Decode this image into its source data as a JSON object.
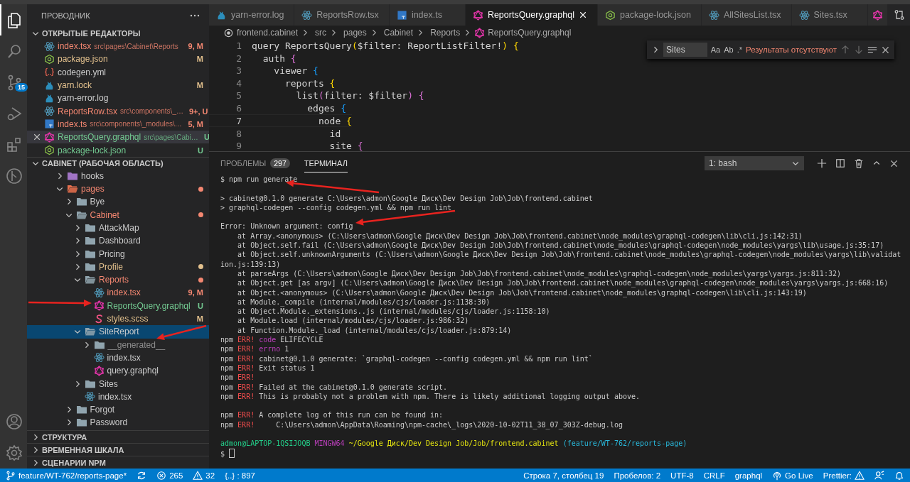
{
  "activity_bar": {
    "items": [
      {
        "kind": "files",
        "selected": true
      },
      {
        "kind": "search",
        "selected": false
      },
      {
        "kind": "source-control",
        "selected": false,
        "badge": "15"
      },
      {
        "kind": "run",
        "selected": false
      },
      {
        "kind": "extensions",
        "selected": false
      },
      {
        "kind": "git-graph",
        "selected": false
      }
    ],
    "bottom": [
      {
        "kind": "account"
      },
      {
        "kind": "settings"
      }
    ]
  },
  "sidebar": {
    "title": "ПРОВОДНИК",
    "open_editors": {
      "title": "ОТКРЫТЫЕ РЕДАКТОРЫ",
      "items": [
        {
          "name": "index.tsx",
          "kind": "react",
          "path": "src\\pages\\Cabinet\\Reports",
          "badge": "9, M",
          "color": "#f48771",
          "selected": false
        },
        {
          "name": "package.json",
          "kind": "json",
          "badge": "M",
          "color": "#e2c08d",
          "selected": false
        },
        {
          "name": "codegen.yml",
          "kind": "yaml",
          "color": "#cccccc",
          "selected": false
        },
        {
          "name": "yarn.lock",
          "kind": "yarn",
          "badge": "M",
          "color": "#e2c08d",
          "selected": false
        },
        {
          "name": "yarn-error.log",
          "kind": "yarn",
          "color": "#cccccc",
          "selected": false
        },
        {
          "name": "ReportsRow.tsx",
          "kind": "react",
          "path": "src\\components\\_…",
          "badge": "9+, U",
          "color": "#f48771",
          "selected": false
        },
        {
          "name": "index.ts",
          "kind": "ts",
          "path": "src\\components\\_modules\\…",
          "badge": "5, M",
          "color": "#f48771",
          "selected": false
        },
        {
          "name": "ReportsQuery.graphql",
          "kind": "graphql",
          "path": "src\\pages\\Cabi…",
          "badge": "U",
          "color": "#73c991",
          "selected": true
        },
        {
          "name": "package-lock.json",
          "kind": "json",
          "badge": "U",
          "color": "#73c991",
          "selected": false
        }
      ]
    },
    "workspace": {
      "title": "CABINET (РАБОЧАЯ ОБЛАСТЬ)",
      "tree": [
        {
          "name": "hooks",
          "kind": "folder-hooks",
          "expanded": false,
          "color": "#cccccc",
          "dot": false,
          "selected": false
        },
        {
          "name": "pages",
          "kind": "folder-pages",
          "expanded": true,
          "color": "#f48771",
          "dot": true,
          "selected": false,
          "children": [
            {
              "name": "Bye",
              "kind": "folder",
              "expanded": false,
              "color": "#cccccc",
              "dot": false,
              "selected": false
            },
            {
              "name": "Cabinet",
              "kind": "folder",
              "expanded": true,
              "color": "#f48771",
              "dot": true,
              "selected": false,
              "children": [
                {
                  "name": "AttackMap",
                  "kind": "folder",
                  "expanded": false,
                  "color": "#cccccc",
                  "dot": false,
                  "selected": false
                },
                {
                  "name": "Dashboard",
                  "kind": "folder",
                  "expanded": false,
                  "color": "#cccccc",
                  "dot": false,
                  "selected": false
                },
                {
                  "name": "Pricing",
                  "kind": "folder",
                  "expanded": false,
                  "color": "#cccccc",
                  "dot": false,
                  "selected": false
                },
                {
                  "name": "Profile",
                  "kind": "folder",
                  "expanded": false,
                  "color": "#e2c08d",
                  "dot": true,
                  "selected": false
                },
                {
                  "name": "Reports",
                  "kind": "folder",
                  "expanded": true,
                  "color": "#f48771",
                  "dot": true,
                  "selected": false,
                  "children": [
                    {
                      "name": "index.tsx",
                      "kind": "react",
                      "badge": "9, M",
                      "color": "#f48771",
                      "selected": false
                    },
                    {
                      "name": "ReportsQuery.graphql",
                      "kind": "graphql",
                      "badge": "U",
                      "color": "#73c991",
                      "selected": false
                    },
                    {
                      "name": "styles.scss",
                      "kind": "scss",
                      "badge": "M",
                      "color": "#e2c08d",
                      "selected": false
                    }
                  ]
                },
                {
                  "name": "SiteReport",
                  "kind": "folder",
                  "expanded": true,
                  "color": "#cccccc",
                  "dot": false,
                  "selected": true,
                  "children": [
                    {
                      "name": "__generated__",
                      "kind": "folder",
                      "expanded": false,
                      "color": "#8c8c8c",
                      "dot": false,
                      "selected": false
                    },
                    {
                      "name": "index.tsx",
                      "kind": "react",
                      "color": "#cccccc",
                      "selected": false
                    },
                    {
                      "name": "query.graphql",
                      "kind": "graphql",
                      "color": "#cccccc",
                      "selected": false
                    }
                  ]
                },
                {
                  "name": "Sites",
                  "kind": "folder",
                  "expanded": false,
                  "color": "#cccccc",
                  "dot": false,
                  "selected": false
                },
                {
                  "name": "index.tsx",
                  "kind": "react",
                  "color": "#cccccc",
                  "selected": false
                }
              ]
            },
            {
              "name": "Forgot",
              "kind": "folder",
              "expanded": false,
              "color": "#cccccc",
              "dot": false,
              "selected": false
            },
            {
              "name": "Password",
              "kind": "folder",
              "expanded": false,
              "color": "#cccccc",
              "dot": false,
              "selected": false
            }
          ]
        }
      ]
    },
    "sections": [
      "СТРУКТУРА",
      "ВРЕМЕННАЯ ШКАЛА",
      "СЦЕНАРИИ NPM"
    ]
  },
  "editor": {
    "tabs": [
      {
        "label": "yarn-error.log",
        "kind": "yarn",
        "selected": false
      },
      {
        "label": "ReportsRow.tsx",
        "kind": "react",
        "selected": false
      },
      {
        "label": "index.ts",
        "kind": "ts",
        "selected": false
      },
      {
        "label": "ReportsQuery.graphql",
        "kind": "graphql",
        "selected": true
      },
      {
        "label": "package-lock.json",
        "kind": "json",
        "selected": false
      },
      {
        "label": "AllSitesList.tsx",
        "kind": "react",
        "selected": false
      },
      {
        "label": "Sites.tsx",
        "kind": "react",
        "selected": false
      },
      {
        "kind": "graphql",
        "selected": false
      }
    ],
    "breadcrumbs": [
      {
        "label": "frontend.cabinet",
        "kind": "root"
      },
      {
        "label": "src",
        "kind": "plain"
      },
      {
        "label": "pages",
        "kind": "plain"
      },
      {
        "label": "Cabinet",
        "kind": "plain"
      },
      {
        "label": "Reports",
        "kind": "plain"
      },
      {
        "label": "ReportsQuery.graphql",
        "kind": "graphql"
      }
    ],
    "lines": [
      {
        "number": "1",
        "current": false,
        "tokens": [
          {
            "text": "query ReportsQuery",
            "kind": "plain"
          },
          {
            "text": "(",
            "kind": "gold"
          },
          {
            "text": "$filter: ReportListFilter!",
            "kind": "plain"
          },
          {
            "text": ") ",
            "kind": "gold"
          },
          {
            "text": "{",
            "kind": "gold"
          }
        ]
      },
      {
        "number": "2",
        "current": false,
        "tokens": [
          {
            "text": "  auth ",
            "kind": "plain"
          },
          {
            "text": "{",
            "kind": "purple"
          }
        ]
      },
      {
        "number": "3",
        "current": false,
        "tokens": [
          {
            "text": "    viewer ",
            "kind": "plain"
          },
          {
            "text": "{",
            "kind": "blue"
          }
        ]
      },
      {
        "number": "4",
        "current": false,
        "tokens": [
          {
            "text": "      reports ",
            "kind": "plain"
          },
          {
            "text": "{",
            "kind": "gold"
          }
        ]
      },
      {
        "number": "5",
        "current": false,
        "tokens": [
          {
            "text": "        list",
            "kind": "plain"
          },
          {
            "text": "(",
            "kind": "purple"
          },
          {
            "text": "filter: $filter",
            "kind": "plain"
          },
          {
            "text": ") ",
            "kind": "purple"
          },
          {
            "text": "{",
            "kind": "purple"
          }
        ]
      },
      {
        "number": "6",
        "current": false,
        "tokens": [
          {
            "text": "          edges ",
            "kind": "plain"
          },
          {
            "text": "{",
            "kind": "blue"
          }
        ]
      },
      {
        "number": "7",
        "current": true,
        "tokens": [
          {
            "text": "            node ",
            "kind": "plain"
          },
          {
            "text": "{",
            "kind": "gold"
          }
        ]
      },
      {
        "number": "8",
        "current": false,
        "tokens": [
          {
            "text": "              id",
            "kind": "plain"
          }
        ]
      },
      {
        "number": "9",
        "current": false,
        "tokens": [
          {
            "text": "              site ",
            "kind": "plain"
          },
          {
            "text": "{",
            "kind": "purple"
          }
        ]
      }
    ],
    "find": {
      "value": "Sites",
      "options": [
        "Aa",
        "Ab",
        ".*"
      ],
      "result": "Результаты отсутствуют"
    }
  },
  "panel": {
    "tabs": [
      {
        "label": "ПРОБЛЕМЫ",
        "badge": "297",
        "selected": false
      },
      {
        "label": "ТЕРМИНАЛ",
        "selected": true
      }
    ],
    "terminal_select": "1: bash",
    "lines": [
      {
        "kind": "text",
        "segments": [
          {
            "text": "$ npm run generate",
            "kind": "plain"
          }
        ]
      },
      {
        "kind": "blank"
      },
      {
        "kind": "text",
        "segments": [
          {
            "text": "> cabinet@0.1.0 generate C:\\Users\\admon\\Google Диск\\Dev Design Job\\Job\\frontend.cabinet",
            "kind": "plain"
          }
        ]
      },
      {
        "kind": "text",
        "segments": [
          {
            "text": "> graphql-codegen --config codegen.yml && npm run lint",
            "kind": "plain"
          }
        ]
      },
      {
        "kind": "blank"
      },
      {
        "kind": "text",
        "segments": [
          {
            "text": "Error: Unknown argument: config",
            "kind": "plain"
          }
        ]
      },
      {
        "kind": "text",
        "segments": [
          {
            "text": "    at Array.<anonymous> (C:\\Users\\admon\\Google Диск\\Dev Design Job\\Job\\frontend.cabinet\\node_modules\\graphql-codegen\\lib\\cli.js:142:31)",
            "kind": "plain"
          }
        ]
      },
      {
        "kind": "text",
        "segments": [
          {
            "text": "    at Object.self.fail (C:\\Users\\admon\\Google Диск\\Dev Design Job\\Job\\frontend.cabinet\\node_modules\\graphql-codegen\\node_modules\\yargs\\lib\\usage.js:35:17)",
            "kind": "plain"
          }
        ]
      },
      {
        "kind": "text",
        "segments": [
          {
            "text": "    at Object.self.unknownArguments (C:\\Users\\admon\\Google Диск\\Dev Design Job\\Job\\frontend.cabinet\\node_modules\\graphql-codegen\\node_modules\\yargs\\lib\\validat",
            "kind": "plain"
          }
        ]
      },
      {
        "kind": "text",
        "segments": [
          {
            "text": "ion.js:139:13)",
            "kind": "plain"
          }
        ]
      },
      {
        "kind": "text",
        "segments": [
          {
            "text": "    at parseArgs (C:\\Users\\admon\\Google Диск\\Dev Design Job\\Job\\frontend.cabinet\\node_modules\\graphql-codegen\\node_modules\\yargs\\yargs.js:811:32)",
            "kind": "plain"
          }
        ]
      },
      {
        "kind": "text",
        "segments": [
          {
            "text": "    at Object.get [as argv] (C:\\Users\\admon\\Google Диск\\Dev Design Job\\Job\\frontend.cabinet\\node_modules\\graphql-codegen\\node_modules\\yargs\\yargs.js:668:16)",
            "kind": "plain"
          }
        ]
      },
      {
        "kind": "text",
        "segments": [
          {
            "text": "    at Object.<anonymous> (C:\\Users\\admon\\Google Диск\\Dev Design Job\\Job\\frontend.cabinet\\node_modules\\graphql-codegen\\lib\\cli.js:143:19)",
            "kind": "plain"
          }
        ]
      },
      {
        "kind": "text",
        "segments": [
          {
            "text": "    at Module._compile (internal/modules/cjs/loader.js:1138:30)",
            "kind": "plain"
          }
        ]
      },
      {
        "kind": "text",
        "segments": [
          {
            "text": "    at Object.Module._extensions..js (internal/modules/cjs/loader.js:1158:10)",
            "kind": "plain"
          }
        ]
      },
      {
        "kind": "text",
        "segments": [
          {
            "text": "    at Module.load (internal/modules/cjs/loader.js:986:32)",
            "kind": "plain"
          }
        ]
      },
      {
        "kind": "text",
        "segments": [
          {
            "text": "    at Function.Module._load (internal/modules/cjs/loader.js:879:14)",
            "kind": "plain"
          }
        ]
      },
      {
        "kind": "text",
        "segments": [
          {
            "text": "npm ",
            "kind": "plain"
          },
          {
            "text": "ERR!",
            "kind": "red"
          },
          {
            "text": " code",
            "kind": "magenta"
          },
          {
            "text": " ELIFECYCLE",
            "kind": "plain"
          }
        ]
      },
      {
        "kind": "text",
        "segments": [
          {
            "text": "npm ",
            "kind": "plain"
          },
          {
            "text": "ERR!",
            "kind": "red"
          },
          {
            "text": " errno",
            "kind": "magenta"
          },
          {
            "text": " 1",
            "kind": "plain"
          }
        ]
      },
      {
        "kind": "text",
        "segments": [
          {
            "text": "npm ",
            "kind": "plain"
          },
          {
            "text": "ERR!",
            "kind": "red"
          },
          {
            "text": " cabinet@0.1.0 generate: `graphql-codegen --config codegen.yml && npm run lint`",
            "kind": "plain"
          }
        ]
      },
      {
        "kind": "text",
        "segments": [
          {
            "text": "npm ",
            "kind": "plain"
          },
          {
            "text": "ERR!",
            "kind": "red"
          },
          {
            "text": " Exit status 1",
            "kind": "plain"
          }
        ]
      },
      {
        "kind": "text",
        "segments": [
          {
            "text": "npm ",
            "kind": "plain"
          },
          {
            "text": "ERR!",
            "kind": "red"
          }
        ]
      },
      {
        "kind": "text",
        "segments": [
          {
            "text": "npm ",
            "kind": "plain"
          },
          {
            "text": "ERR!",
            "kind": "red"
          },
          {
            "text": " Failed at the cabinet@0.1.0 generate script.",
            "kind": "plain"
          }
        ]
      },
      {
        "kind": "text",
        "segments": [
          {
            "text": "npm ",
            "kind": "plain"
          },
          {
            "text": "ERR!",
            "kind": "red"
          },
          {
            "text": " This is probably not a problem with npm. There is likely additional logging output above.",
            "kind": "plain"
          }
        ]
      },
      {
        "kind": "blank"
      },
      {
        "kind": "text",
        "segments": [
          {
            "text": "npm ",
            "kind": "plain"
          },
          {
            "text": "ERR!",
            "kind": "red"
          },
          {
            "text": " A complete log of this run can be found in:",
            "kind": "plain"
          }
        ]
      },
      {
        "kind": "text",
        "segments": [
          {
            "text": "npm ",
            "kind": "plain"
          },
          {
            "text": "ERR!",
            "kind": "red"
          },
          {
            "text": "     C:\\Users\\admon\\AppData\\Roaming\\npm-cache\\_logs\\2020-10-02T11_38_07_303Z-debug.log",
            "kind": "plain"
          }
        ]
      },
      {
        "kind": "blank"
      },
      {
        "kind": "text",
        "segments": [
          {
            "text": "admon@LAPTOP-1QSIJOQB",
            "kind": "green"
          },
          {
            "text": " MINGW64",
            "kind": "magenta"
          },
          {
            "text": " ~/Google Диск/Dev Design Job/Job/frontend.cabinet",
            "kind": "yellow"
          },
          {
            "text": " (feature/WT-762/reports-page)",
            "kind": "cyan"
          }
        ]
      },
      {
        "kind": "prompt",
        "segments": [
          {
            "text": "$",
            "kind": "plain"
          }
        ]
      }
    ]
  },
  "status_bar": {
    "left": [
      {
        "kind": "branch",
        "text": "feature/WT-762/reports-page*"
      },
      {
        "kind": "sync"
      },
      {
        "kind": "errors",
        "text": "265"
      },
      {
        "kind": "warnings",
        "text": "32"
      },
      {
        "kind": "plain",
        "text": "{..} : 897"
      }
    ],
    "right": [
      {
        "kind": "plain",
        "text": "Строка 7, столбец 19"
      },
      {
        "kind": "plain",
        "text": "Пробелов: 2"
      },
      {
        "kind": "plain",
        "text": "UTF-8"
      },
      {
        "kind": "plain",
        "text": "CRLF"
      },
      {
        "kind": "plain",
        "text": "graphql"
      },
      {
        "kind": "live",
        "text": "Go Live"
      },
      {
        "kind": "prettier",
        "text": "Prettier:"
      },
      {
        "kind": "feedback"
      },
      {
        "kind": "bell"
      }
    ]
  }
}
